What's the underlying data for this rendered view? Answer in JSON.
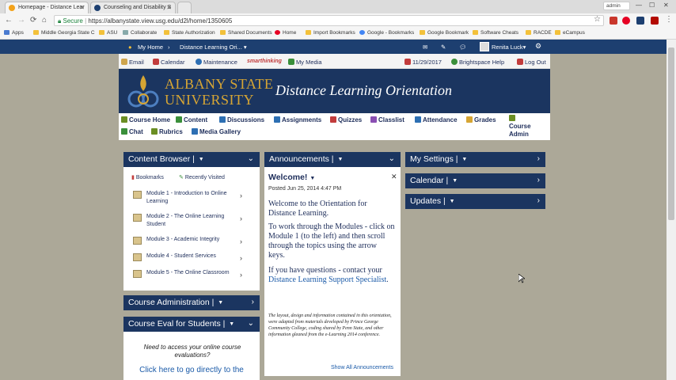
{
  "browser": {
    "tabs": [
      {
        "title": "Homepage - Distance Lear",
        "icon_color": "#f3a21a"
      },
      {
        "title": "Counseling and Disability S",
        "icon_color": "#1d3f70"
      }
    ],
    "secure_label": "Secure",
    "url": "https://albanystate.view.usg.edu/d2l/home/1350605",
    "user_chip": "admin",
    "bookmarks": [
      "Apps",
      "Middle Georgia State C",
      "ASU",
      "Collaborate",
      "State Authorization",
      "Shared Documents",
      "Home",
      "Import Bookmarks",
      "Google - Bookmarks",
      "Google Bookmark",
      "Software Cheats",
      "RACDE",
      "eCampus"
    ]
  },
  "d2l_nav": {
    "my_home": "My Home",
    "course_selector": "Distance Learning Ori...",
    "user_name": "Renita Luck"
  },
  "minibar": {
    "email": "Email",
    "calendar": "Calendar",
    "maintenance": "Maintenance",
    "smarthinking": "smarthinking",
    "my_media": "My Media",
    "date": "11/29/2017",
    "help": "Brightspace Help",
    "logout": "Log Out"
  },
  "banner": {
    "logo_line1": "ALBANY STATE",
    "logo_line2": "UNIVERSITY",
    "title": "Distance Learning Orientation",
    "colors": {
      "navy": "#1b3560",
      "gold": "#d6a534"
    }
  },
  "course_nav": {
    "course_home": "Course Home",
    "content": "Content",
    "discussions": "Discussions",
    "assignments": "Assignments",
    "quizzes": "Quizzes",
    "classlist": "Classlist",
    "attendance": "Attendance",
    "grades": "Grades",
    "course_admin_1": "Course",
    "course_admin_2": "Admin",
    "chat": "Chat",
    "rubrics": "Rubrics",
    "media_gallery": "Media Gallery"
  },
  "content_browser": {
    "title": "Content Browser",
    "bookmarks": "Bookmarks",
    "recently_visited": "Recently Visited",
    "modules": [
      "Module 1 - Introduction to Online Learning",
      "Module 2 - The Online Learning Student",
      "Module 3 - Academic Integrity",
      "Module 4 - Student Services",
      "Module 5 - The Online Classroom"
    ]
  },
  "course_administration": {
    "title": "Course Administration"
  },
  "course_eval": {
    "title": "Course Eval for Students",
    "need_access": "Need to access your online course evaluations?",
    "click_here": "Click here to go directly to the"
  },
  "announcements": {
    "title": "Announcements",
    "item_title": "Welcome!",
    "posted": "Posted Jun 25, 2014 4:47 PM",
    "para1": "Welcome to the Orientation for Distance Learning.",
    "para2": "To work through the Modules - click on Module 1 (to the left) and then scroll through the topics using the arrow keys.",
    "para3_prefix": "If you have questions - contact your ",
    "para3_link": "Distance Learning Support Specialist",
    "para3_suffix": ".",
    "fine_print": "The layout, design and information contained in this orientation, were adapted from materials developed by Prince George Community College, coding shared by Penn State, and other information gleaned from the e-Learning 2014 conference.",
    "show_all": "Show All Announcements"
  },
  "my_settings": {
    "title": "My Settings"
  },
  "calendar_widget": {
    "title": "Calendar"
  },
  "updates": {
    "title": "Updates"
  }
}
